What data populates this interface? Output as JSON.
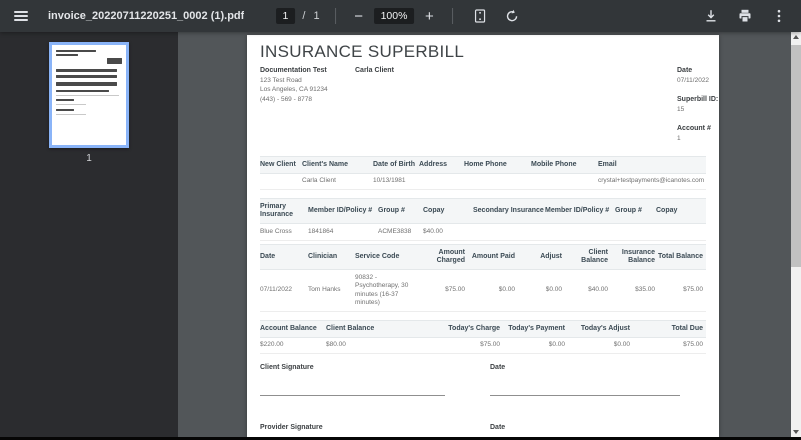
{
  "toolbar": {
    "filename": "invoice_20220711220251_0002 (1).pdf",
    "page_current": "1",
    "page_separator": "/",
    "page_total": "1",
    "zoom_out_label": "−",
    "zoom_level": "100%",
    "zoom_in_label": "+",
    "icons": {
      "menu": "hamburger-icon",
      "fit": "fit-to-page-icon",
      "rotate": "rotate-counterclockwise-icon",
      "download": "download-icon",
      "print": "print-icon",
      "more": "more-vertical-icon"
    }
  },
  "sidebar": {
    "thumbnail_page_label": "1"
  },
  "doc": {
    "title": "INSURANCE SUPERBILL",
    "practice": {
      "name": "Documentation Test",
      "address_line1": "123 Test Road",
      "address_line2": "Los Angeles, CA 91234",
      "phone": "(443) - 569 - 8778"
    },
    "client_name": "Carla Client",
    "meta": {
      "date_label": "Date",
      "date_value": "07/11/2022",
      "superbill_label": "Superbill ID:",
      "superbill_value": "15",
      "account_label": "Account #",
      "account_value": "1"
    },
    "client_table": {
      "headers": [
        "New Client",
        "Client's Name",
        "Date of Birth",
        "Address",
        "Home Phone",
        "Mobile Phone",
        "Email"
      ],
      "row": [
        "",
        "Carla Client",
        "10/13/1981",
        "",
        "",
        "",
        "crystal+testpayments@icanotes.com"
      ]
    },
    "insurance_table": {
      "headers": [
        "Primary Insurance",
        "Member ID/Policy #",
        "Group #",
        "Copay",
        "Secondary Insurance",
        "Member ID/Policy #",
        "Group #",
        "Copay"
      ],
      "row": [
        "Blue Cross",
        "1841864",
        "ACME3838",
        "$40.00",
        "",
        "",
        "",
        ""
      ]
    },
    "service_table": {
      "headers": [
        "Date",
        "Clinician",
        "Service Code",
        "Amount Charged",
        "Amount Paid",
        "Adjust",
        "Client Balance",
        "Insurance Balance",
        "Total Balance"
      ],
      "row": [
        "07/11/2022",
        "Tom Hanks",
        "90832 - Psychotherapy, 30 minutes (16-37 minutes)",
        "$75.00",
        "$0.00",
        "$0.00",
        "$40.00",
        "$35.00",
        "$75.00"
      ]
    },
    "balance_table": {
      "headers": [
        "Account Balance",
        "Client Balance",
        "Today's Charge",
        "Today's Payment",
        "Today's Adjust",
        "Total Due"
      ],
      "row": [
        "$220.00",
        "$80.00",
        "$75.00",
        "$0.00",
        "$0.00",
        "$75.00"
      ]
    },
    "signatures": {
      "client_label": "Client Signature",
      "client_date_label": "Date",
      "provider_label": "Provider Signature",
      "provider_date_label": "Date"
    }
  },
  "colors": {
    "toolbar_bg": "#323639",
    "sidebar_bg": "#2b2c2f",
    "viewer_bg": "#525659",
    "thumbnail_selected_border": "#8ab4f8",
    "toolbar_icon": "#dee1e6",
    "table_header_bg": "#f4f6f7"
  }
}
